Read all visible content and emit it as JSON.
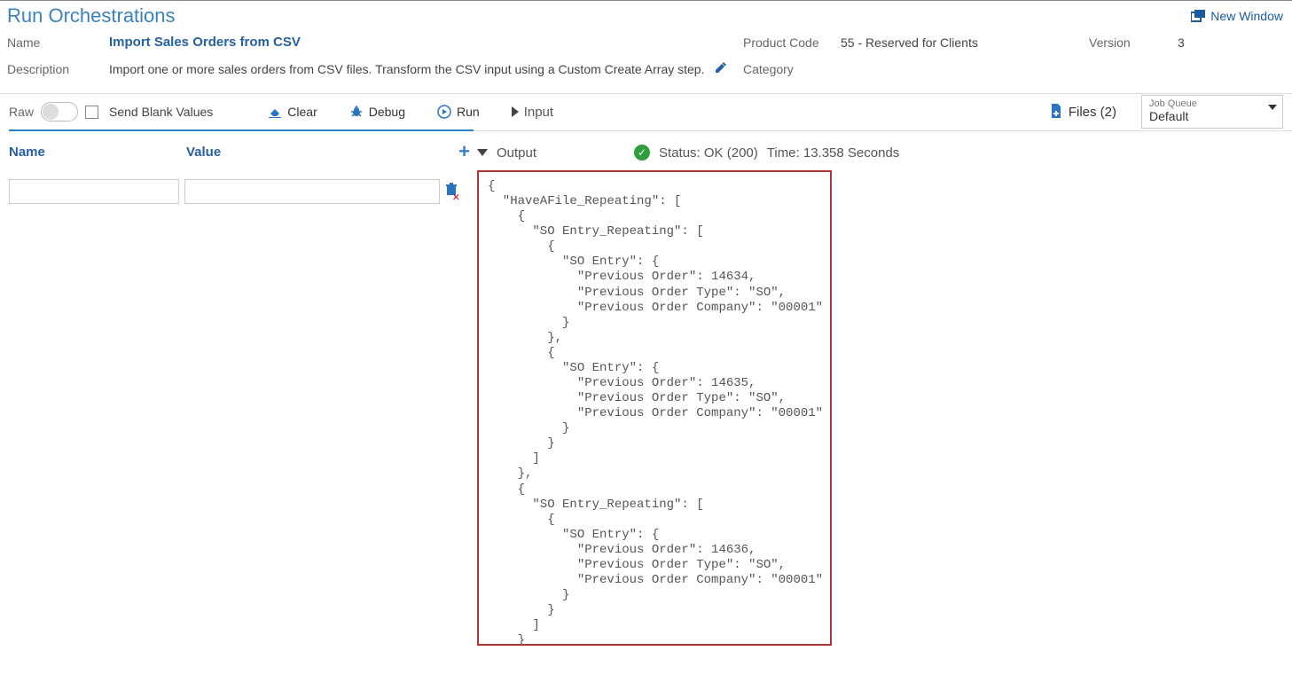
{
  "page_title": "Run Orchestrations",
  "new_window_label": "New Window",
  "header": {
    "name_label": "Name",
    "name_value": "Import Sales Orders from CSV",
    "product_code_label": "Product Code",
    "product_code_value": "55 - Reserved for Clients",
    "version_label": "Version",
    "version_value": "3",
    "description_label": "Description",
    "description_value": "Import one or more sales orders from CSV files. Transform the CSV input using a Custom Create Array step.",
    "category_label": "Category",
    "category_value": ""
  },
  "toolbar": {
    "raw_label": "Raw",
    "send_blank_label": "Send Blank Values",
    "clear_label": "Clear",
    "debug_label": "Debug",
    "run_label": "Run",
    "input_label": "Input",
    "files_label": "Files (2)",
    "job_queue_label": "Job Queue",
    "job_queue_value": "Default"
  },
  "params_table": {
    "col_name": "Name",
    "col_value": "Value"
  },
  "output": {
    "label": "Output",
    "status_label": "Status: OK (200)",
    "time_label": "Time: 13.358 Seconds",
    "json_text": "{\n  \"HaveAFile_Repeating\": [\n    {\n      \"SO Entry_Repeating\": [\n        {\n          \"SO Entry\": {\n            \"Previous Order\": 14634,\n            \"Previous Order Type\": \"SO\",\n            \"Previous Order Company\": \"00001\"\n          }\n        },\n        {\n          \"SO Entry\": {\n            \"Previous Order\": 14635,\n            \"Previous Order Type\": \"SO\",\n            \"Previous Order Company\": \"00001\"\n          }\n        }\n      ]\n    },\n    {\n      \"SO Entry_Repeating\": [\n        {\n          \"SO Entry\": {\n            \"Previous Order\": 14636,\n            \"Previous Order Type\": \"SO\",\n            \"Previous Order Company\": \"00001\"\n          }\n        }\n      ]\n    }"
  }
}
